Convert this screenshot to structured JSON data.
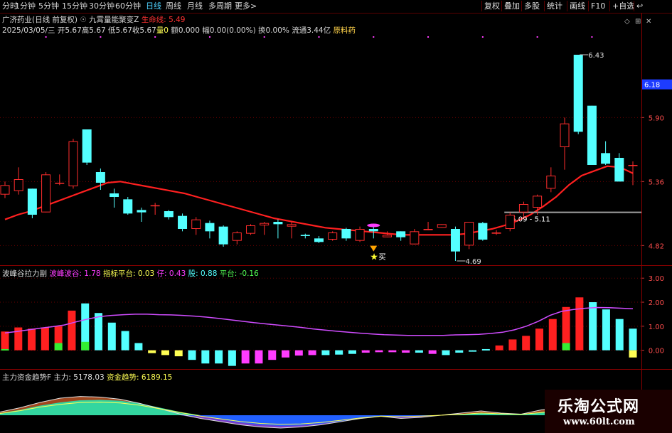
{
  "toolbar": {
    "timeframes": [
      "分时",
      "1分钟",
      "5分钟",
      "15分钟",
      "30分钟",
      "60分钟",
      "日线",
      "周线",
      "月线",
      "多周期",
      "更多>"
    ],
    "active_index": 6,
    "right_buttons": [
      "复权",
      "叠加",
      "多股",
      "统计",
      "画线",
      "F10",
      "+自选"
    ],
    "back_icon": "back-arrow-icon"
  },
  "info": {
    "stock_name": "广济药业(日线 前复权)",
    "indicator_name": "九霄量能聚变Z",
    "lifeline_label": "生命线: 5.49",
    "date": "2025/03/05/三",
    "open": "开5.67",
    "high": "高5.67",
    "low": "低5.67",
    "close": "收5.67",
    "volume": "量0",
    "amount": "额0.000",
    "change": "幅0.00(0.00%)",
    "turnover": "换0.00%",
    "float": "流通3.44亿",
    "sector": "原料药"
  },
  "price_panel": {
    "y_ticks": [
      "5.90",
      "5.36",
      "4.82"
    ],
    "current_price_tag": "6.18",
    "high_marker": "6.43",
    "low_marker": "4.69",
    "range_label": "5.09 - 5.11",
    "buy_label": "买",
    "colors": {
      "up": "#ff2d2d",
      "down": "#54ffff",
      "ma": "#ff2020",
      "range": "#a0a0a0",
      "grid": "#6a0000"
    }
  },
  "panel2": {
    "title": "波峰谷拉力副",
    "legend": [
      {
        "label": "波峰波谷: 1.78",
        "color": "#ff3cff"
      },
      {
        "label": "指标平台: 0.03",
        "color": "#ffff54"
      },
      {
        "label": "仔: 0.43",
        "color": "#ff3cff"
      },
      {
        "label": "股: 0.88",
        "color": "#54ffff"
      },
      {
        "label": "平台: -0.16",
        "color": "#54ff54"
      }
    ],
    "y_ticks": [
      "3.00",
      "2.00",
      "1.00",
      "0.00"
    ]
  },
  "panel3": {
    "title": "主力资金趋势F",
    "legend": [
      {
        "label": "主力: 5178.03",
        "color": "#e0e0e0"
      },
      {
        "label": "资金趋势: 6189.15",
        "color": "#ffff54"
      }
    ]
  },
  "watermark": {
    "title": "乐淘公式网",
    "url": "www.60lt.com"
  },
  "chart_data": [
    {
      "type": "candlestick",
      "title": "广济药业(日线 前复权)",
      "ylim": [
        4.66,
        6.58
      ],
      "y_ticks": [
        5.9,
        5.36,
        4.82
      ],
      "candles": [
        [
          5.25,
          5.33,
          5.36,
          5.22
        ],
        [
          5.28,
          5.38,
          5.48,
          5.25
        ],
        [
          5.3,
          5.08,
          5.3,
          5.05
        ],
        [
          5.1,
          5.42,
          5.44,
          5.1
        ],
        [
          5.35,
          5.35,
          5.42,
          5.33
        ],
        [
          5.32,
          5.7,
          5.72,
          5.3
        ],
        [
          5.8,
          5.52,
          5.8,
          5.5
        ],
        [
          5.44,
          5.35,
          5.47,
          5.29
        ],
        [
          5.26,
          5.23,
          5.3,
          5.14
        ],
        [
          5.21,
          5.09,
          5.23,
          5.08
        ],
        [
          5.12,
          5.1,
          5.14,
          5.02
        ],
        [
          5.16,
          5.16,
          5.18,
          5.08
        ],
        [
          5.11,
          5.06,
          5.12,
          5.04
        ],
        [
          5.07,
          4.96,
          5.09,
          4.94
        ],
        [
          4.96,
          5.04,
          5.06,
          4.91
        ],
        [
          5.01,
          4.94,
          5.03,
          4.88
        ],
        [
          4.98,
          4.83,
          4.99,
          4.81
        ],
        [
          4.86,
          4.93,
          4.94,
          4.83
        ],
        [
          4.92,
          4.99,
          5.0,
          4.91
        ],
        [
          4.99,
          5.01,
          5.02,
          4.91
        ],
        [
          5.02,
          5.0,
          5.04,
          4.88
        ],
        [
          4.98,
          5.0,
          5.02,
          4.88
        ],
        [
          4.91,
          4.9,
          4.92,
          4.88
        ],
        [
          4.88,
          4.85,
          4.9,
          4.84
        ],
        [
          4.87,
          4.93,
          4.94,
          4.86
        ],
        [
          4.96,
          4.88,
          4.97,
          4.86
        ],
        [
          4.86,
          4.96,
          4.98,
          4.85
        ],
        [
          4.96,
          4.94,
          4.98,
          4.88
        ],
        [
          4.89,
          4.91,
          4.94,
          4.89
        ],
        [
          4.94,
          4.89,
          4.94,
          4.86
        ],
        [
          4.83,
          4.94,
          4.96,
          4.83
        ],
        [
          4.95,
          4.96,
          5.02,
          4.95
        ],
        [
          4.97,
          5.0,
          5.0,
          4.97
        ],
        [
          4.96,
          4.77,
          4.98,
          4.69
        ],
        [
          4.82,
          5.02,
          5.02,
          4.79
        ],
        [
          5.01,
          4.87,
          5.02,
          4.86
        ],
        [
          4.92,
          4.93,
          4.95,
          4.91
        ],
        [
          4.96,
          5.08,
          5.1,
          4.94
        ],
        [
          5.1,
          5.17,
          5.19,
          5.06
        ],
        [
          5.14,
          5.24,
          5.25,
          5.08
        ],
        [
          5.3,
          5.41,
          5.48,
          5.27
        ],
        [
          5.65,
          5.85,
          5.9,
          5.46
        ],
        [
          6.43,
          5.78,
          6.43,
          5.76
        ],
        [
          6.0,
          5.5,
          6.0,
          5.5
        ],
        [
          5.6,
          5.51,
          5.7,
          5.5
        ],
        [
          5.56,
          5.36,
          5.6,
          5.36
        ],
        [
          5.5,
          5.5,
          5.53,
          5.33
        ]
      ],
      "ma": [
        5.04,
        5.08,
        5.11,
        5.15,
        5.19,
        5.23,
        5.27,
        5.31,
        5.35,
        5.36,
        5.34,
        5.32,
        5.3,
        5.28,
        5.26,
        5.23,
        5.2,
        5.17,
        5.14,
        5.11,
        5.08,
        5.05,
        5.03,
        5.01,
        4.99,
        4.97,
        4.96,
        4.95,
        4.94,
        4.93,
        4.92,
        4.91,
        4.91,
        4.91,
        4.91,
        4.91,
        4.92,
        4.94,
        4.96,
        4.99,
        5.03,
        5.08,
        5.15,
        5.23,
        5.33,
        5.41,
        5.45,
        5.49,
        5.48,
        5.43
      ],
      "range_line": [
        5.1,
        5.1
      ],
      "buy_signal_index": 27,
      "high_marker": 6.43,
      "low_marker": 4.69
    },
    {
      "type": "bar",
      "title": "波峰谷拉力副",
      "ylim": [
        -0.75,
        3.45
      ],
      "y_ticks": [
        3.0,
        2.0,
        1.0,
        0.0
      ],
      "bars": [
        [
          0.78,
          "r"
        ],
        [
          0.95,
          "r"
        ],
        [
          0.9,
          "r"
        ],
        [
          0.95,
          "r"
        ],
        [
          1.0,
          "r"
        ],
        [
          1.65,
          "r"
        ],
        [
          1.95,
          "c"
        ],
        [
          1.55,
          "c"
        ],
        [
          1.15,
          "c"
        ],
        [
          0.8,
          "c"
        ],
        [
          0.3,
          "c"
        ],
        [
          -0.12,
          "y"
        ],
        [
          -0.2,
          "y"
        ],
        [
          -0.25,
          "y"
        ],
        [
          -0.4,
          "c"
        ],
        [
          -0.55,
          "c"
        ],
        [
          -0.55,
          "c"
        ],
        [
          -0.65,
          "c"
        ],
        [
          -0.55,
          "m"
        ],
        [
          -0.55,
          "m"
        ],
        [
          -0.4,
          "m"
        ],
        [
          -0.3,
          "m"
        ],
        [
          -0.22,
          "m"
        ],
        [
          -0.2,
          "m"
        ],
        [
          -0.2,
          "c"
        ],
        [
          -0.18,
          "c"
        ],
        [
          -0.15,
          "c"
        ],
        [
          -0.1,
          "m"
        ],
        [
          -0.08,
          "m"
        ],
        [
          -0.08,
          "m"
        ],
        [
          -0.1,
          "m"
        ],
        [
          -0.1,
          "c"
        ],
        [
          -0.15,
          "m"
        ],
        [
          -0.2,
          "c"
        ],
        [
          -0.1,
          "c"
        ],
        [
          -0.05,
          "c"
        ],
        [
          0.05,
          "c"
        ],
        [
          0.2,
          "r"
        ],
        [
          0.45,
          "r"
        ],
        [
          0.6,
          "r"
        ],
        [
          0.9,
          "r"
        ],
        [
          1.3,
          "r"
        ],
        [
          1.8,
          "r"
        ],
        [
          2.2,
          "r"
        ],
        [
          2.0,
          "c"
        ],
        [
          1.7,
          "c"
        ],
        [
          1.3,
          "c"
        ],
        [
          0.9,
          "c"
        ]
      ],
      "bottom_segments": [
        [
          0,
          0.05,
          "g"
        ],
        [
          4,
          0.3,
          "g"
        ],
        [
          6,
          0.35,
          "g"
        ],
        [
          42,
          0.3,
          "g"
        ],
        [
          47,
          -0.3,
          "y"
        ]
      ],
      "line": [
        0.72,
        0.78,
        0.85,
        0.92,
        0.98,
        1.05,
        1.18,
        1.3,
        1.4,
        1.45,
        1.48,
        1.5,
        1.5,
        1.48,
        1.47,
        1.45,
        1.42,
        1.38,
        1.33,
        1.27,
        1.21,
        1.15,
        1.1,
        1.05,
        1.0,
        0.95,
        0.89,
        0.84,
        0.79,
        0.75,
        0.71,
        0.68,
        0.65,
        0.63,
        0.62,
        0.62,
        0.62,
        0.62,
        0.64,
        0.65,
        0.66,
        0.7,
        0.75,
        0.85,
        1.0,
        1.2,
        1.45,
        1.62,
        1.7,
        1.75,
        1.78,
        1.77,
        1.75,
        1.73
      ]
    },
    {
      "type": "area",
      "title": "主力资金趋势F",
      "series": [
        {
          "name": "主力",
          "values": [
            0.15,
            0.35,
            0.6,
            0.8,
            0.88,
            0.85,
            0.75,
            0.55,
            0.3,
            0.05,
            -0.15,
            -0.3,
            -0.45,
            -0.55,
            -0.6,
            -0.55,
            -0.45,
            -0.3,
            -0.15,
            -0.05,
            -0.15,
            -0.1,
            0.0,
            0.1,
            0.2,
            0.1,
            0.05,
            0.25,
            0.35,
            0.55,
            0.75,
            0.9,
            0.95
          ]
        },
        {
          "name": "资金趋势",
          "values": [
            0.1,
            0.25,
            0.45,
            0.6,
            0.7,
            0.72,
            0.68,
            0.55,
            0.35,
            0.15,
            -0.05,
            -0.2,
            -0.35,
            -0.45,
            -0.5,
            -0.48,
            -0.4,
            -0.28,
            -0.15,
            -0.05,
            -0.08,
            -0.05,
            0.0,
            0.05,
            0.12,
            0.08,
            0.05,
            0.15,
            0.25,
            0.4,
            0.6,
            0.75,
            0.85
          ]
        }
      ]
    }
  ]
}
